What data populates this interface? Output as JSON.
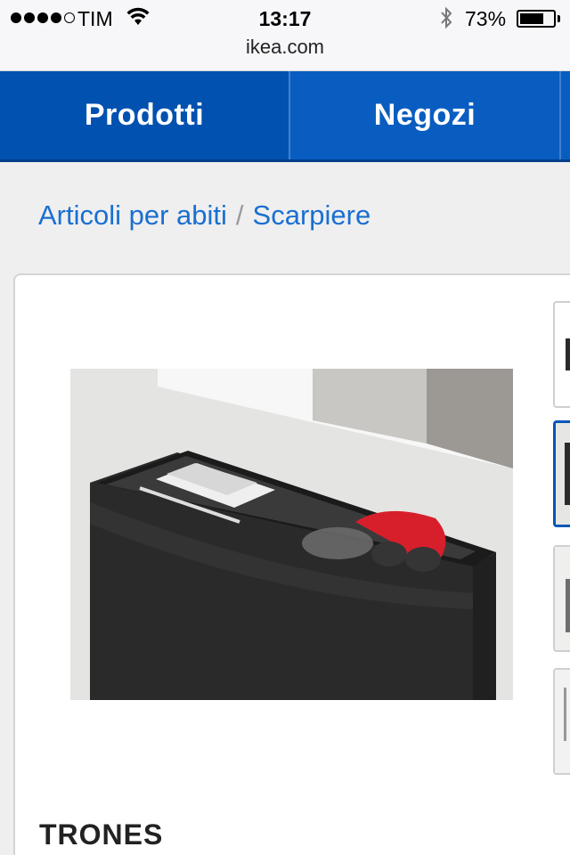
{
  "status_bar": {
    "carrier": "TIM",
    "time": "13:17",
    "battery_percent": "73%",
    "battery_level": 0.73,
    "signal_bars": 4,
    "url": "ikea.com"
  },
  "nav": {
    "tabs": [
      {
        "label": "Prodotti"
      },
      {
        "label": "Negozi"
      }
    ],
    "colors": {
      "primary": "#0057b8"
    }
  },
  "breadcrumb": {
    "items": [
      {
        "label": "Articoli per abiti"
      },
      {
        "label": "Scarpiere"
      }
    ],
    "separator": "/"
  },
  "product": {
    "name": "TRONES",
    "main_image": "shoe-cabinet-photo",
    "thumbnails": [
      {
        "name": "thumb-1",
        "active": false
      },
      {
        "name": "thumb-2",
        "active": true
      },
      {
        "name": "thumb-3",
        "active": false
      },
      {
        "name": "thumb-4",
        "active": false
      }
    ]
  }
}
